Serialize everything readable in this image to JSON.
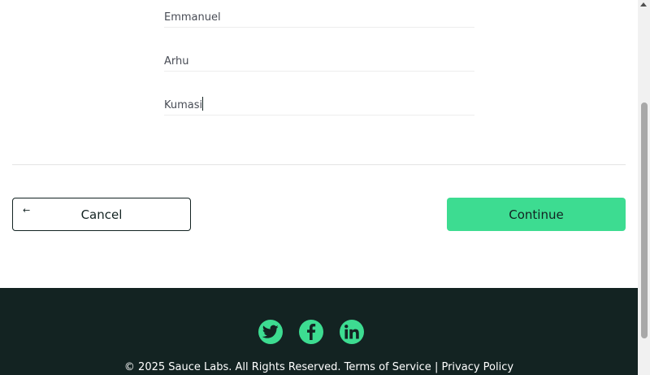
{
  "checkout": {
    "first_name": "Emmanuel",
    "last_name": "Arhu",
    "postal_code": "Kumasi"
  },
  "actions": {
    "cancel_label": "Cancel",
    "cancel_icon": "arrow-left-icon",
    "continue_label": "Continue"
  },
  "footer": {
    "social": [
      "twitter-icon",
      "facebook-icon",
      "linkedin-icon"
    ],
    "copyright": "© 2025 Sauce Labs. All Rights Reserved.",
    "terms": "Terms of Service",
    "separator": "|",
    "privacy": "Privacy Policy"
  },
  "colors": {
    "accent": "#3ddc91",
    "footer_bg": "#132322",
    "text": "#132322"
  }
}
